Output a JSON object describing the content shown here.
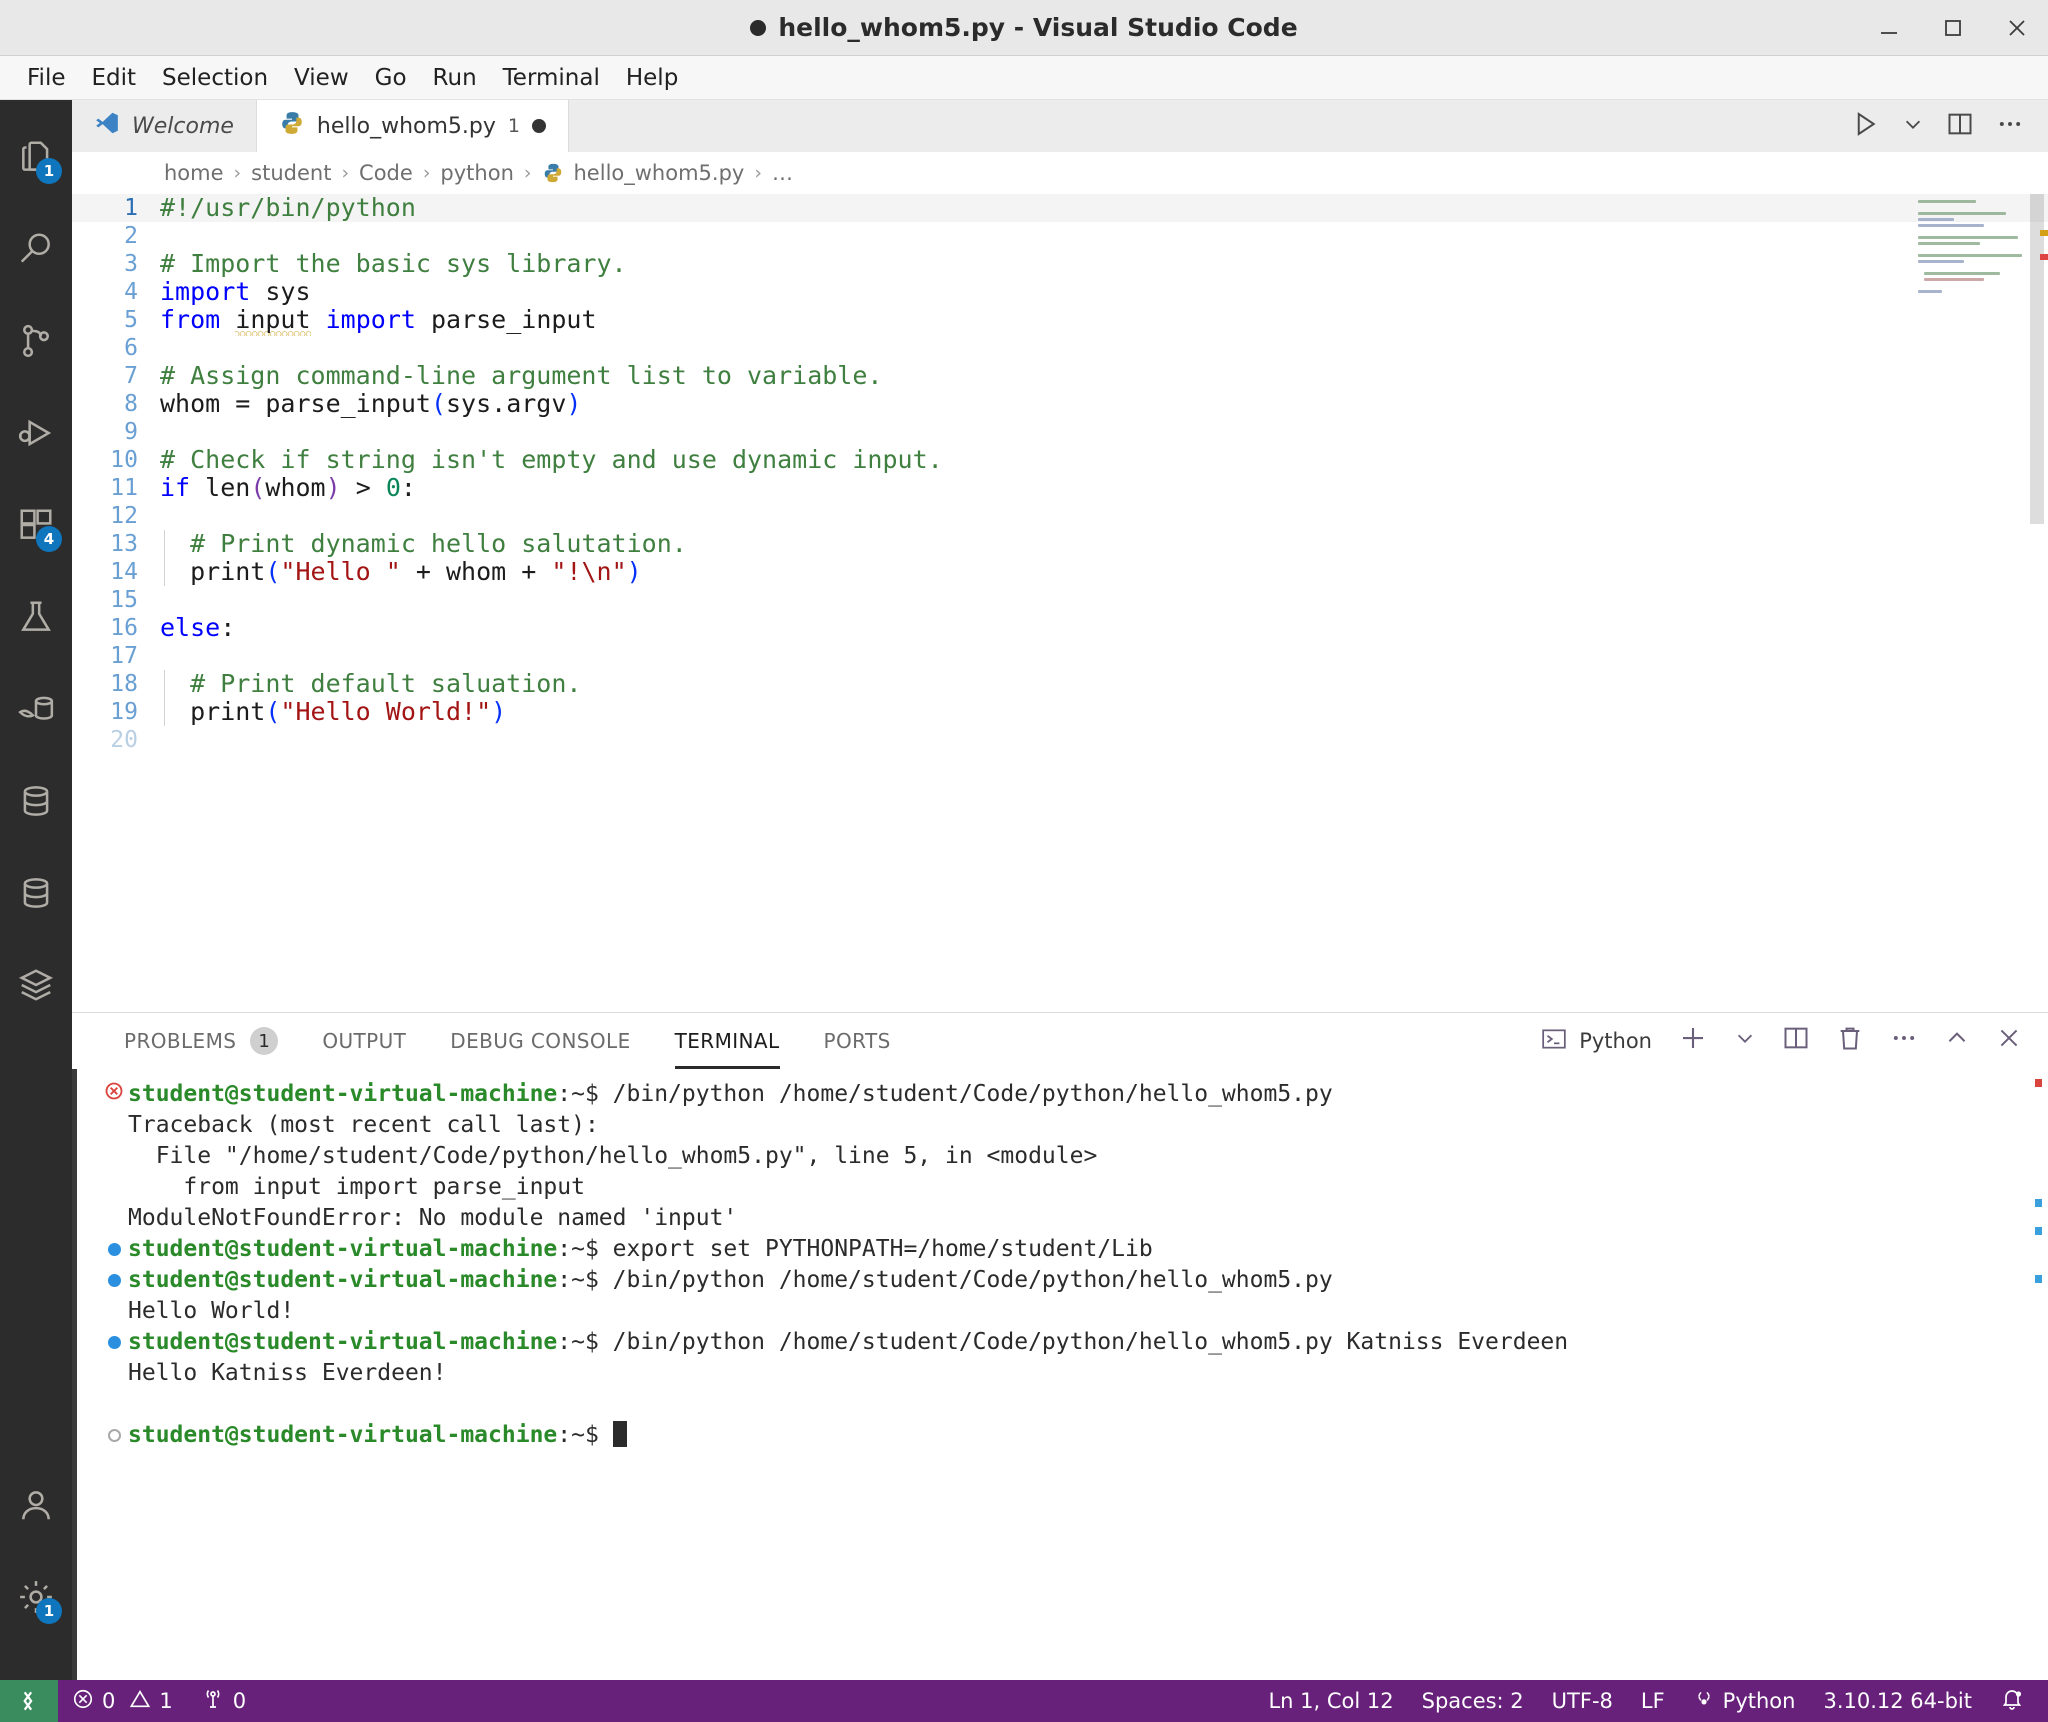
{
  "window": {
    "title": "hello_whom5.py - Visual Studio Code",
    "dirty": true,
    "minimize_label": "Minimize",
    "maximize_label": "Maximize",
    "close_label": "Close"
  },
  "menubar": {
    "items": [
      "File",
      "Edit",
      "Selection",
      "View",
      "Go",
      "Run",
      "Terminal",
      "Help"
    ]
  },
  "activitybar": {
    "items": [
      {
        "name": "explorer",
        "icon": "files-icon",
        "badge": "1"
      },
      {
        "name": "search",
        "icon": "search-icon",
        "badge": ""
      },
      {
        "name": "source-control",
        "icon": "source-control-icon",
        "badge": ""
      },
      {
        "name": "run-and-debug",
        "icon": "run-debug-icon",
        "badge": ""
      },
      {
        "name": "extensions",
        "icon": "extensions-icon",
        "badge": "4"
      },
      {
        "name": "testing",
        "icon": "beaker-icon",
        "badge": ""
      },
      {
        "name": "mysql",
        "icon": "dolphin-database-icon",
        "badge": ""
      },
      {
        "name": "database-1",
        "icon": "database-icon",
        "badge": ""
      },
      {
        "name": "database-2",
        "icon": "database-icon",
        "badge": ""
      },
      {
        "name": "layers",
        "icon": "layers-icon",
        "badge": ""
      }
    ],
    "bottom": [
      {
        "name": "accounts",
        "icon": "account-icon",
        "badge": ""
      },
      {
        "name": "settings",
        "icon": "gear-icon",
        "badge": "1"
      }
    ]
  },
  "tabs": [
    {
      "label": "Welcome",
      "icon": "vscode-logo-icon",
      "active": false,
      "italic": true,
      "badge": "",
      "dirty": false
    },
    {
      "label": "hello_whom5.py",
      "icon": "python-icon",
      "active": true,
      "italic": false,
      "badge": "1",
      "dirty": true
    }
  ],
  "tab_actions": [
    {
      "name": "run-python-file-button",
      "icon": "play-icon"
    },
    {
      "name": "run-options-chevron",
      "icon": "chevron-down-icon"
    },
    {
      "name": "split-editor-button",
      "icon": "split-editor-icon"
    },
    {
      "name": "more-actions-button",
      "icon": "ellipsis-icon"
    }
  ],
  "breadcrumb": {
    "parts": [
      "home",
      "student",
      "Code",
      "python",
      "hello_whom5.py",
      "…"
    ],
    "separator": "›"
  },
  "editor": {
    "language": "python",
    "lines": [
      {
        "n": 1,
        "tokens": [
          {
            "t": "#!/usr/bin/python",
            "c": "cm"
          }
        ],
        "indent": 0,
        "highlight": true
      },
      {
        "n": 2,
        "tokens": [],
        "indent": 0,
        "highlight": false
      },
      {
        "n": 3,
        "tokens": [
          {
            "t": "# Import the basic sys library.",
            "c": "cm"
          }
        ],
        "indent": 0,
        "highlight": false
      },
      {
        "n": 4,
        "tokens": [
          {
            "t": "import",
            "c": "k"
          },
          {
            "t": " sys",
            "c": "fn"
          }
        ],
        "indent": 0,
        "highlight": false
      },
      {
        "n": 5,
        "tokens": [
          {
            "t": "from",
            "c": "k"
          },
          {
            "t": " ",
            "c": "fn"
          },
          {
            "t": "input",
            "c": "squig"
          },
          {
            "t": " ",
            "c": "fn"
          },
          {
            "t": "import",
            "c": "k"
          },
          {
            "t": " parse_input",
            "c": "fn"
          }
        ],
        "indent": 0,
        "highlight": false
      },
      {
        "n": 6,
        "tokens": [],
        "indent": 0,
        "highlight": false
      },
      {
        "n": 7,
        "tokens": [
          {
            "t": "# Assign command-line argument list to variable.",
            "c": "cm"
          }
        ],
        "indent": 0,
        "highlight": false
      },
      {
        "n": 8,
        "tokens": [
          {
            "t": "whom = parse_input",
            "c": "fn"
          },
          {
            "t": "(",
            "c": "paren1"
          },
          {
            "t": "sys.argv",
            "c": "fn"
          },
          {
            "t": ")",
            "c": "paren1"
          }
        ],
        "indent": 0,
        "highlight": false
      },
      {
        "n": 9,
        "tokens": [],
        "indent": 0,
        "highlight": false
      },
      {
        "n": 10,
        "tokens": [
          {
            "t": "# Check if string isn't empty and use dynamic input.",
            "c": "cm"
          }
        ],
        "indent": 0,
        "highlight": false
      },
      {
        "n": 11,
        "tokens": [
          {
            "t": "if",
            "c": "k"
          },
          {
            "t": " len",
            "c": "fn"
          },
          {
            "t": "(",
            "c": "paren2"
          },
          {
            "t": "whom",
            "c": "fn"
          },
          {
            "t": ")",
            "c": "paren2"
          },
          {
            "t": " > ",
            "c": "fn"
          },
          {
            "t": "0",
            "c": "num"
          },
          {
            "t": ":",
            "c": "fn"
          }
        ],
        "indent": 0,
        "highlight": false
      },
      {
        "n": 12,
        "tokens": [],
        "indent": 1,
        "highlight": false
      },
      {
        "n": 13,
        "tokens": [
          {
            "t": "  # Print dynamic hello salutation.",
            "c": "cm"
          }
        ],
        "indent": 1,
        "highlight": false
      },
      {
        "n": 14,
        "tokens": [
          {
            "t": "  print",
            "c": "fn"
          },
          {
            "t": "(",
            "c": "paren1"
          },
          {
            "t": "\"Hello \"",
            "c": "st"
          },
          {
            "t": " + whom + ",
            "c": "fn"
          },
          {
            "t": "\"!\\n\"",
            "c": "st"
          },
          {
            "t": ")",
            "c": "paren1"
          }
        ],
        "indent": 1,
        "highlight": false
      },
      {
        "n": 15,
        "tokens": [],
        "indent": 0,
        "highlight": false
      },
      {
        "n": 16,
        "tokens": [
          {
            "t": "else",
            "c": "k"
          },
          {
            "t": ":",
            "c": "fn"
          }
        ],
        "indent": 0,
        "highlight": false
      },
      {
        "n": 17,
        "tokens": [],
        "indent": 1,
        "highlight": false
      },
      {
        "n": 18,
        "tokens": [
          {
            "t": "  # Print default saluation.",
            "c": "cm"
          }
        ],
        "indent": 1,
        "highlight": false
      },
      {
        "n": 19,
        "tokens": [
          {
            "t": "  print",
            "c": "fn"
          },
          {
            "t": "(",
            "c": "paren1"
          },
          {
            "t": "\"Hello World!\"",
            "c": "st"
          },
          {
            "t": ")",
            "c": "paren1"
          }
        ],
        "indent": 1,
        "highlight": false
      },
      {
        "n": 20,
        "tokens": [],
        "indent": 0,
        "highlight": false,
        "dim": true
      }
    ]
  },
  "panel": {
    "tabs": [
      {
        "label": "PROBLEMS",
        "badge": "1",
        "active": false
      },
      {
        "label": "OUTPUT",
        "badge": "",
        "active": false
      },
      {
        "label": "DEBUG CONSOLE",
        "badge": "",
        "active": false
      },
      {
        "label": "TERMINAL",
        "badge": "",
        "active": true
      },
      {
        "label": "PORTS",
        "badge": "",
        "active": false
      }
    ],
    "terminal_selector_label": "Python",
    "tools": [
      {
        "name": "new-terminal-button",
        "icon": "plus-icon"
      },
      {
        "name": "terminal-profile-chevron",
        "icon": "chevron-down-icon"
      },
      {
        "name": "split-terminal-button",
        "icon": "split-icon"
      },
      {
        "name": "kill-terminal-button",
        "icon": "trash-icon"
      },
      {
        "name": "panel-more-actions-button",
        "icon": "ellipsis-icon"
      },
      {
        "name": "maximize-panel-button",
        "icon": "chevron-up-icon"
      },
      {
        "name": "close-panel-button",
        "icon": "close-icon"
      }
    ]
  },
  "terminal": {
    "prompt_user": "student@student-virtual-machine",
    "prompt_tail": ":~$",
    "lines": [
      {
        "mark": "error",
        "type": "prompt",
        "command": " /bin/python /home/student/Code/python/hello_whom5.py"
      },
      {
        "mark": "",
        "type": "output",
        "text": "Traceback (most recent call last):"
      },
      {
        "mark": "",
        "type": "output",
        "text": "  File \"/home/student/Code/python/hello_whom5.py\", line 5, in <module>"
      },
      {
        "mark": "",
        "type": "output",
        "text": "    from input import parse_input"
      },
      {
        "mark": "",
        "type": "output",
        "text": "ModuleNotFoundError: No module named 'input'"
      },
      {
        "mark": "success",
        "type": "prompt",
        "command": " export set PYTHONPATH=/home/student/Lib"
      },
      {
        "mark": "success",
        "type": "prompt",
        "command": " /bin/python /home/student/Code/python/hello_whom5.py"
      },
      {
        "mark": "",
        "type": "output",
        "text": "Hello World!"
      },
      {
        "mark": "success",
        "type": "prompt",
        "command": " /bin/python /home/student/Code/python/hello_whom5.py Katniss Everdeen"
      },
      {
        "mark": "",
        "type": "output",
        "text": "Hello Katniss Everdeen!"
      },
      {
        "mark": "",
        "type": "output",
        "text": ""
      },
      {
        "mark": "pending",
        "type": "prompt",
        "command": " ",
        "cursor": true
      }
    ]
  },
  "statusbar": {
    "remote_icon": "remote-window-icon",
    "left": [
      {
        "name": "errors-warnings",
        "icon": "error-warning-icon",
        "errors": "0",
        "warnings": "1"
      },
      {
        "name": "radio-tower",
        "icon": "radio-tower-icon",
        "value": "0"
      }
    ],
    "right": [
      {
        "name": "editor-position",
        "label": "Ln 1, Col 12"
      },
      {
        "name": "editor-indentation",
        "label": "Spaces: 2"
      },
      {
        "name": "editor-encoding",
        "label": "UTF-8"
      },
      {
        "name": "editor-eol",
        "label": "LF"
      },
      {
        "name": "editor-language",
        "label": "Python",
        "icon": "brackets-icon"
      },
      {
        "name": "python-interpreter",
        "label": "3.10.12 64-bit"
      },
      {
        "name": "notifications",
        "label": "",
        "icon": "bell-dot-icon"
      }
    ]
  },
  "colors": {
    "accent": "#68217a",
    "remote": "#3a8c5f",
    "badge": "#0f75bd",
    "comment": "#3f7f3f",
    "keyword": "#0000ff",
    "string": "#a31515",
    "number": "#098658",
    "terminal_user": "#2a8a2a",
    "error": "#d9453d"
  }
}
